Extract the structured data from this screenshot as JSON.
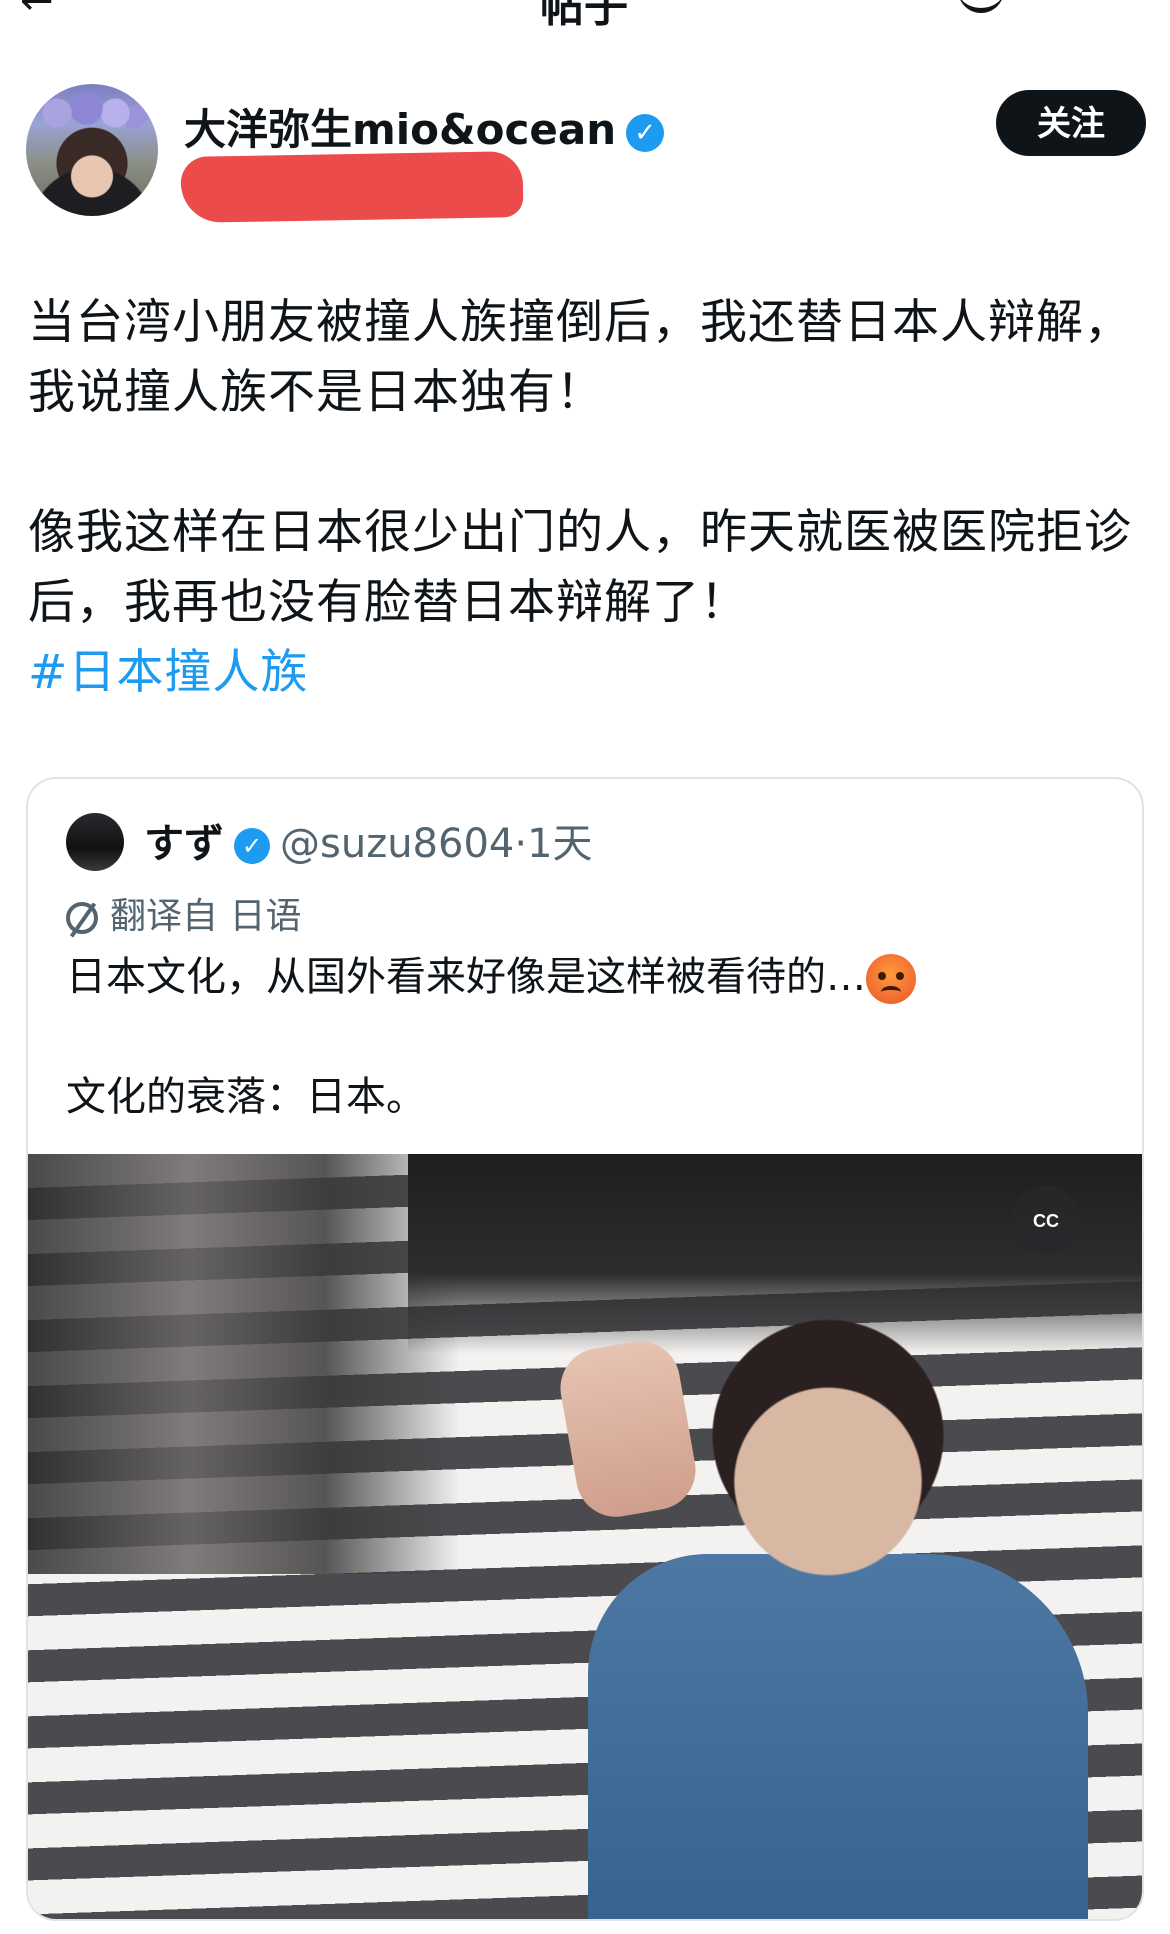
{
  "header": {
    "back_icon": "back-arrow-icon",
    "title": "帖子",
    "grok_icon": "grok-icon"
  },
  "post": {
    "author": {
      "display_name": "大洋弥生mio&ocean",
      "verified": true,
      "handle_redacted": true
    },
    "follow_label": "关注",
    "paragraphs": [
      "当台湾小朋友被撞人族撞倒后，我还替日本人辩解，我说撞人族不是日本独有！",
      "像我这样在日本很少出门的人，昨天就医被医院拒诊后，我再也没有脸替日本辩解了！"
    ],
    "hashtag": "#日本撞人族"
  },
  "quote": {
    "author": {
      "display_name": "すず",
      "verified": true,
      "handle": "@suzu8604",
      "time": "1天"
    },
    "translate_label": "翻译自 日语",
    "lines": [
      "日本文化，从国外看来好像是这样被看待的…",
      "文化的衰落：日本。"
    ],
    "emoji": "angry-face-emoji",
    "video": {
      "cc_label": "CC"
    }
  },
  "colors": {
    "accent": "#1d9bf0",
    "redaction": "#ec4b4b",
    "text": "#0f1419",
    "muted": "#536471"
  }
}
